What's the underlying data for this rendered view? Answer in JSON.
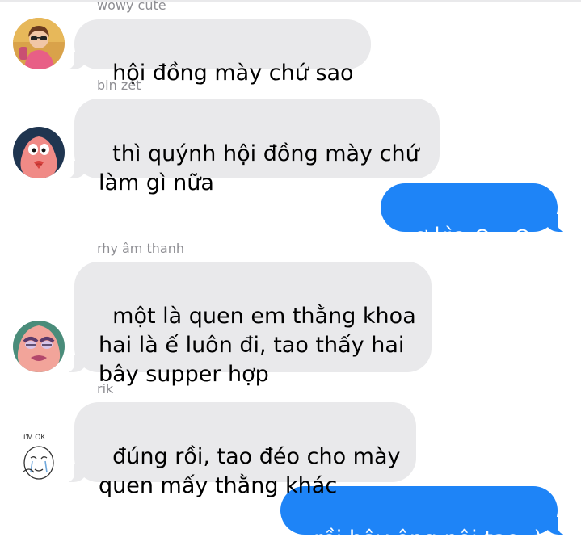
{
  "conversation": {
    "messages": [
      {
        "sender": "wowy cute",
        "direction": "incoming",
        "avatar": "girl-photo-avatar",
        "text": "hội đồng mày chứ sao"
      },
      {
        "sender": "bin zét",
        "direction": "incoming",
        "avatar": "patrick-star-avatar",
        "text": "thì quýnh hội đồng mày chứ\nlàm gì nữa"
      },
      {
        "sender": "",
        "direction": "outgoing",
        "avatar": "",
        "text": "ơ kìa ⊙﹏⊙"
      },
      {
        "sender": "rhy âm thanh",
        "direction": "incoming",
        "avatar": "patrick-lipstick-avatar",
        "text": "một là quen em thằng khoa\nhai là ế luôn đi, tao thấy hai\nbây supper hợp"
      },
      {
        "sender": "rik",
        "direction": "incoming",
        "avatar": "im-ok-sticker-avatar",
        "text": "đúng rồi, tao đéo cho mày\nquen mấy thằng khác"
      },
      {
        "sender": "",
        "direction": "outgoing",
        "avatar": "",
        "text": "rồi bây ông nội tao :)"
      }
    ]
  },
  "avatars": {
    "im_ok_caption": "I'M OK"
  },
  "colors": {
    "incoming_bubble": "#e9e9eb",
    "outgoing_bubble": "#1e84f7",
    "sender_name": "#8e8e93"
  }
}
